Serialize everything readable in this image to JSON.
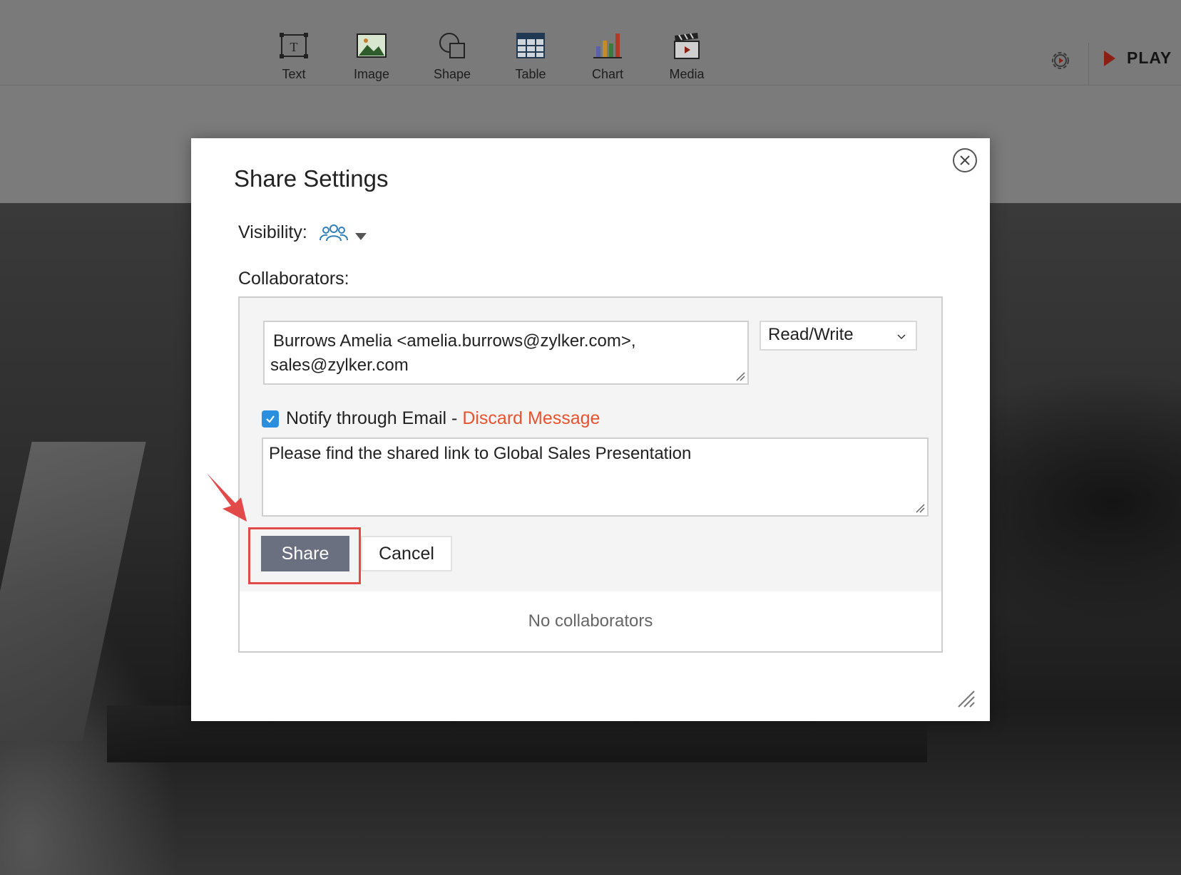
{
  "toolbar": {
    "items": [
      {
        "label": "Text",
        "icon": "text-box-icon"
      },
      {
        "label": "Image",
        "icon": "image-icon"
      },
      {
        "label": "Shape",
        "icon": "shape-icon"
      },
      {
        "label": "Table",
        "icon": "table-icon"
      },
      {
        "label": "Chart",
        "icon": "bar-chart-icon"
      },
      {
        "label": "Media",
        "icon": "media-clapper-icon"
      }
    ],
    "play_label": "PLAY"
  },
  "dialog": {
    "title": "Share Settings",
    "visibility_label": "Visibility:",
    "collaborators_label": "Collaborators:",
    "emails_line1": "Burrows Amelia <amelia.burrows@zylker.com>,",
    "emails_line2": "sales@zylker.com",
    "permission": "Read/Write",
    "notify_checked": true,
    "notify_label": "Notify through Email - ",
    "discard_label": "Discard Message",
    "message": "Please find the shared link to Global Sales Presentation",
    "share_label": "Share",
    "cancel_label": "Cancel",
    "empty_state": "No collaborators"
  },
  "colors": {
    "accent_red": "#e24a4a",
    "discard_link": "#e5532f",
    "checkbox_blue": "#2b8fe0",
    "share_button": "#6b7080"
  }
}
